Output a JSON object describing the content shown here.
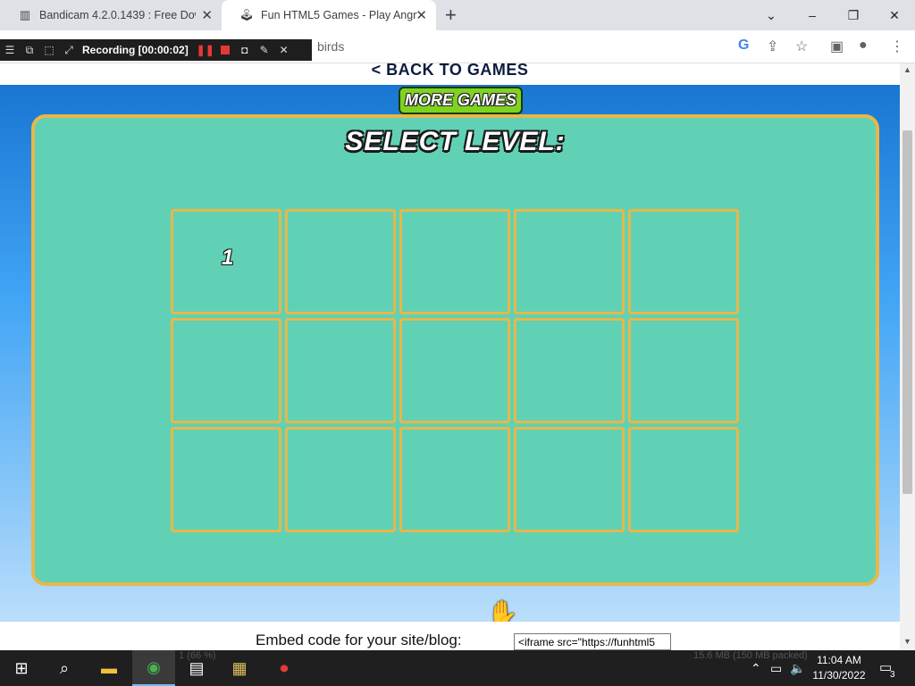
{
  "tabs": [
    {
      "title": "Bandicam 4.2.0.1439 : Free Down",
      "icon": "bandicam-icon"
    },
    {
      "title": "Fun HTML5 Games - Play Angry",
      "icon": "joystick-icon"
    }
  ],
  "window": {
    "minimize": "–",
    "restore": "❐",
    "close": "✕",
    "chevron": "⌄",
    "new_tab": "+"
  },
  "address": {
    "url_fragment": "birds"
  },
  "recording": {
    "label": "Recording [00:00:02]"
  },
  "game": {
    "back_link": "< BACK TO GAMES",
    "more_games": "MORE GAMES",
    "title": "SELECT LEVEL:",
    "levels": [
      "1",
      "",
      "",
      "",
      "",
      "",
      "",
      "",
      "",
      "",
      "",
      "",
      "",
      "",
      ""
    ]
  },
  "embed": {
    "label": "Embed code for your site/blog:",
    "code": "<iframe src=\"https://funhtml5"
  },
  "taskbar": {
    "time": "11:04 AM",
    "date": "11/30/2022",
    "notification_count": "3",
    "overlay_left": "1 (66 %)",
    "overlay_right": "15.6 MB (150 MB packed)"
  }
}
